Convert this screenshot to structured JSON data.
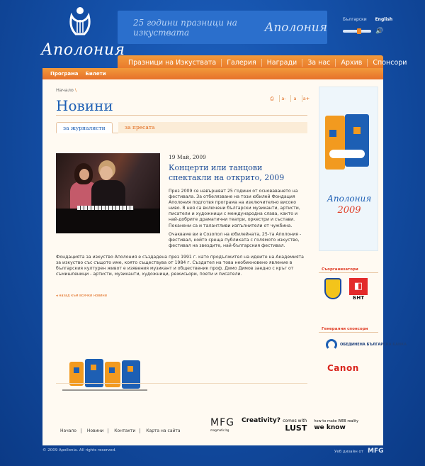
{
  "logo": {
    "text": "Аполония"
  },
  "banner": {
    "slogan": "25 години празници на изкуствата",
    "brand": "Аполония"
  },
  "languages": [
    {
      "label": "Български"
    },
    {
      "label": "English"
    }
  ],
  "main_nav": [
    "Празници на Изкуствата",
    "Галерия",
    "Награди",
    "За нас",
    "Архив",
    "Спонсори"
  ],
  "sub_nav": [
    "Програма",
    "Билети"
  ],
  "breadcrumb": {
    "home": "Начало",
    "sep": "\\"
  },
  "page_title": "Новини",
  "tools": {
    "print": "⎙",
    "smaller": "a-",
    "normal": "a",
    "larger": "a+"
  },
  "tabs": {
    "journalists": "за журналисти",
    "press": "за пресата"
  },
  "article": {
    "date": "19 Май, 2009",
    "headline": "Концерти или танцови спектакли на открито, 2009",
    "p1": "През 2009 се навършват 25 години от основаването на фестивала. За отбелязване на този юбилей Фондация Аполония подготвя програма на изключително високо ниво. В нея са включени български музиканти, артисти, писатели и художници с международна слава, както и най-добрите драматични театри, оркестри и състави. Поканени са и талантливи изпълнители от чужбина.",
    "p2": "Очакваме ви в Созопол на юбилейната, 25-та Аполония - фестивал, който среща публиката с голямото изкуство, фестивал на звездите, най-българския фестивал.",
    "p3": "Фондацията за изкуство Аполония е създадена през 1991 г. като продължител на идеите на Академията за изкуство със същото име, която съществува от 1984 г. Създател на това необикновено явление в българския културен живот е изявения музикант и общественик проф. Димо Димов заедно с кръг от съмишленици - артисти, музиканти, художници, режисьори, поети и писатели."
  },
  "back_link": "◂ назад към всички новини",
  "footer_links": [
    "Начало",
    "Новини",
    "Контакти",
    "Карта на сайта"
  ],
  "partners": {
    "mfg": "MFG",
    "mfg_sub": "magmatic.bg",
    "creativity": "Creativity?",
    "creativity_tag": "comes with",
    "lust": "LUST",
    "weknow_small": "how to make WEB reality",
    "weknow": "we know"
  },
  "poster": {
    "title": "Аполония",
    "year": "2009"
  },
  "sidebar": {
    "coorganizers_title": "Съорганизатори",
    "bnt_label": "БНТ",
    "sponsors_title": "Генерални спонсори",
    "ubb_text": "ОБЕДИНЕНА БЪЛГАРСКА БАНКА",
    "canon": "Canon"
  },
  "copyright": "© 2009 Apollonia. All rights reserved.",
  "credit": {
    "label": "Уеб дизайн от",
    "mark": "MFG"
  },
  "colors": {
    "accent": "#e8762a",
    "blue": "#1d5fb4",
    "bg": "#1450a8"
  }
}
